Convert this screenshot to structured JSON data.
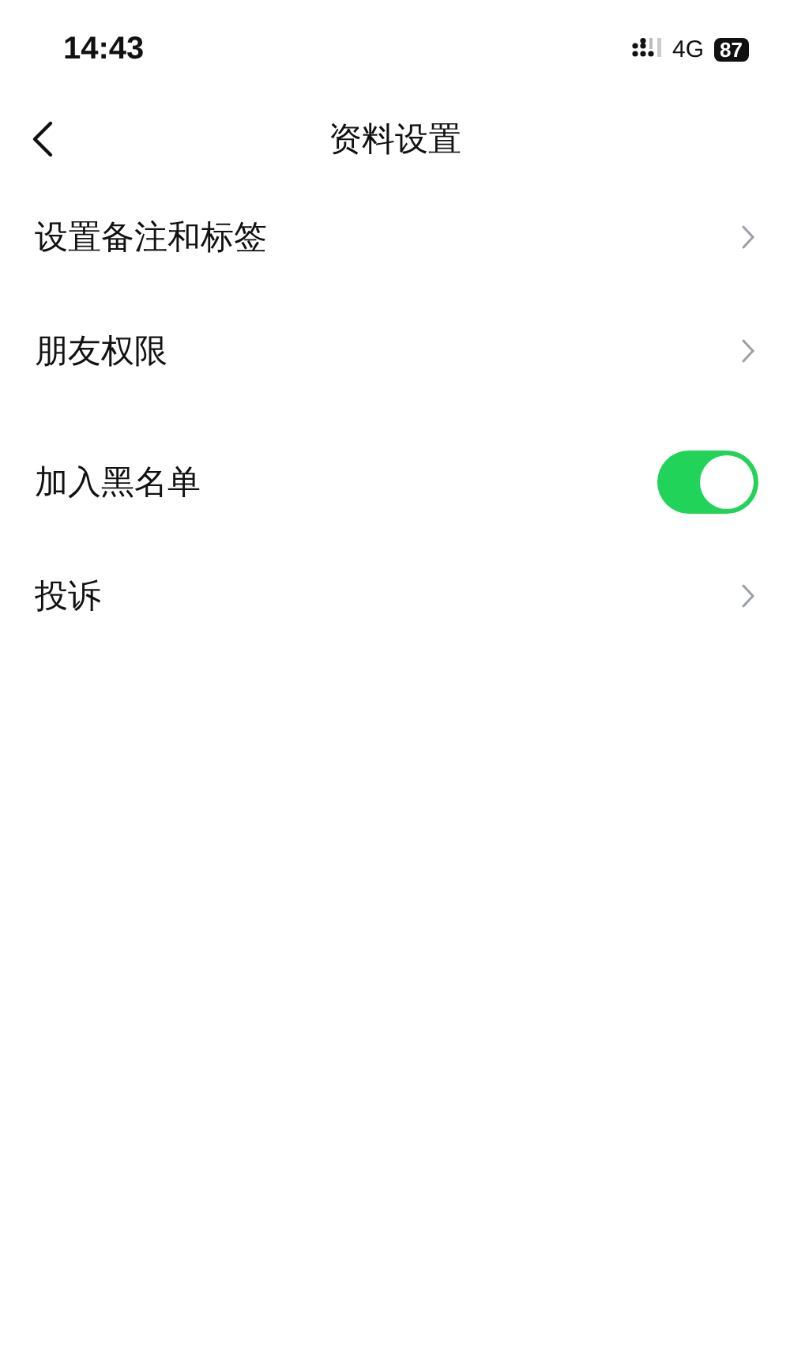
{
  "status_bar": {
    "time": "14:43",
    "network": "4G",
    "battery": "87"
  },
  "nav": {
    "title": "资料设置"
  },
  "items": [
    {
      "kind": "link",
      "label": "设置备注和标签"
    },
    {
      "kind": "link",
      "label": "朋友权限"
    },
    {
      "kind": "toggle",
      "label": "加入黑名单",
      "on": true
    },
    {
      "kind": "link",
      "label": "投诉"
    }
  ]
}
